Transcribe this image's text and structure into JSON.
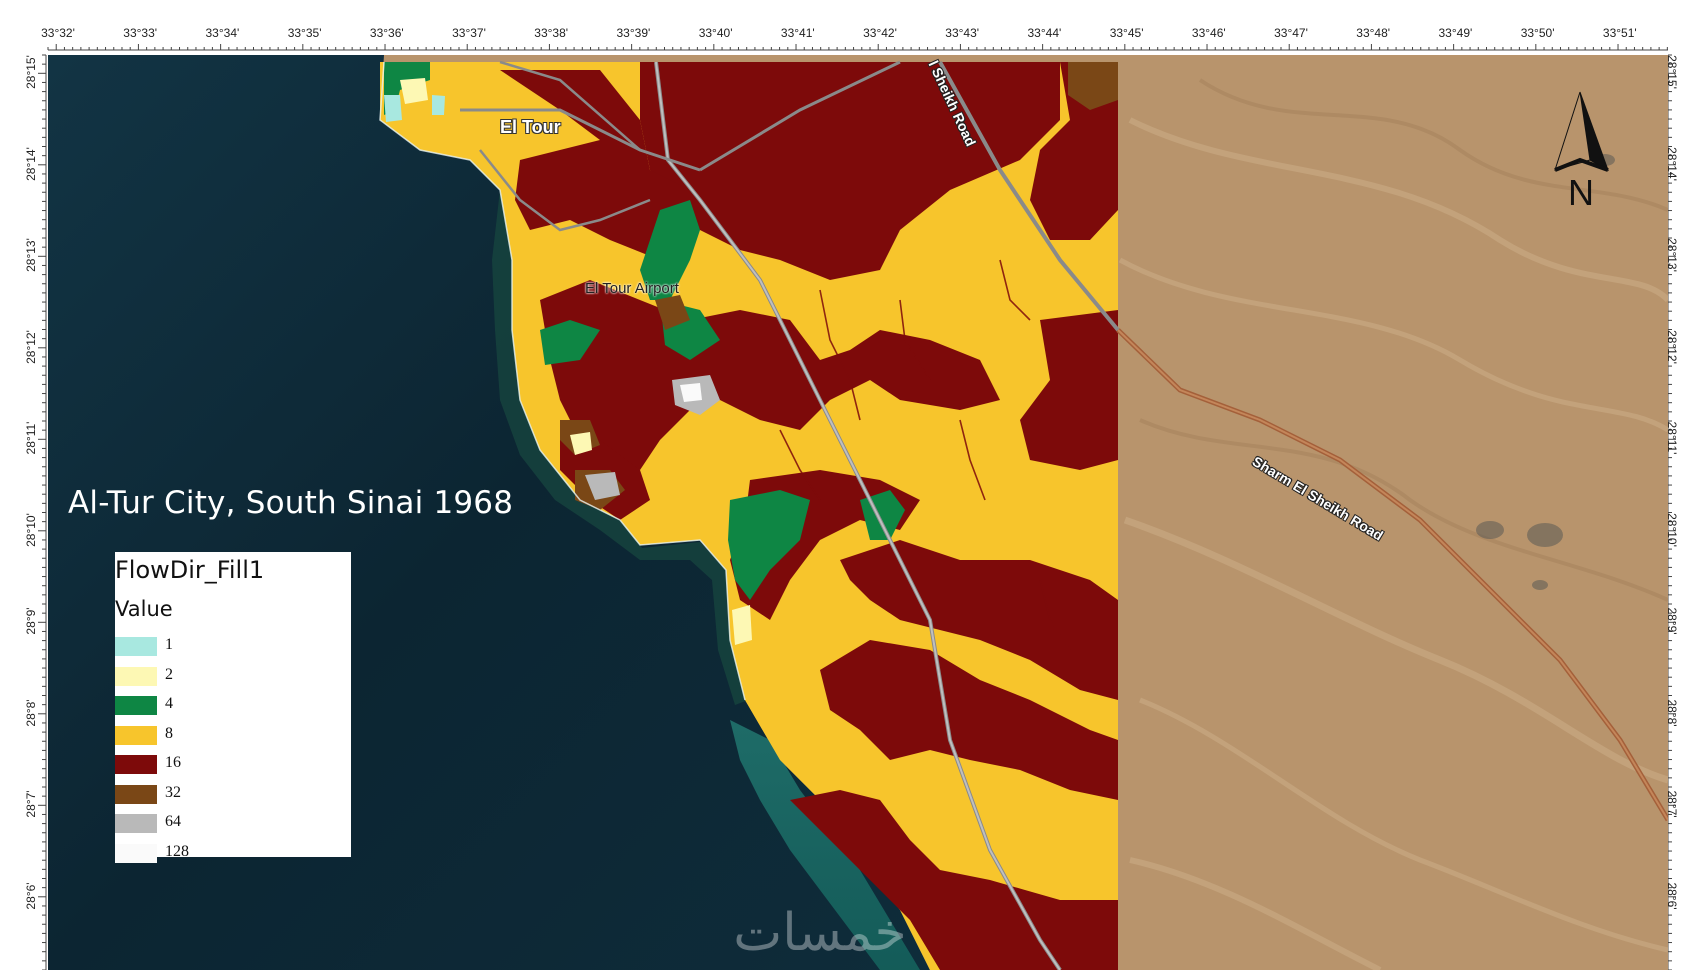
{
  "map": {
    "title": "Al-Tur City, South Sinai 1968",
    "top_axis_labels": [
      "33°32'",
      "33°33'",
      "33°34'",
      "33°35'",
      "33°36'",
      "33°37'",
      "33°38'",
      "33°39'",
      "33°40'",
      "33°41'",
      "33°42'",
      "33°43'",
      "33°44'",
      "33°45'",
      "33°46'",
      "33°47'",
      "33°48'",
      "33°49'",
      "33°50'",
      "33°51'"
    ],
    "left_axis_labels": [
      "28°15'",
      "28°14'",
      "28°13'",
      "28°12'",
      "28°11'",
      "28°10'",
      "28°9'",
      "28°8'",
      "28°7'",
      "28°6'"
    ],
    "right_axis_labels": [
      "28°15'",
      "28°14'",
      "28°13'",
      "28°12'",
      "28°11'",
      "28°10'",
      "28°9'",
      "28°8'",
      "28°7'",
      "28°6'"
    ],
    "north_letter": "N",
    "places": {
      "city": "El Tour",
      "airport": "El Tour Airport",
      "road_main": "Sharm El Sheikh Road",
      "road_top": "l Sheikh Road"
    },
    "watermark": "خمسات",
    "colors": {
      "sea": "#0d2733",
      "desert": "#b8946c",
      "value_1": "#a8e8e0",
      "value_2": "#fdf8b4",
      "value_4": "#0e8644",
      "value_8": "#f7c52c",
      "value_16": "#7d0a0a",
      "value_32": "#7a4716",
      "value_64": "#b9b9b9",
      "value_128": "#fafafa"
    }
  },
  "legend": {
    "title": "FlowDir_Fill1",
    "subtitle": "Value",
    "items": [
      {
        "label": "1",
        "color": "#a8e8e0"
      },
      {
        "label": "2",
        "color": "#fdf8b4"
      },
      {
        "label": "4",
        "color": "#0e8644"
      },
      {
        "label": "8",
        "color": "#f7c52c"
      },
      {
        "label": "16",
        "color": "#7d0a0a"
      },
      {
        "label": "32",
        "color": "#7a4716"
      },
      {
        "label": "64",
        "color": "#b9b9b9"
      },
      {
        "label": "128",
        "color": "#fafafa"
      }
    ]
  }
}
